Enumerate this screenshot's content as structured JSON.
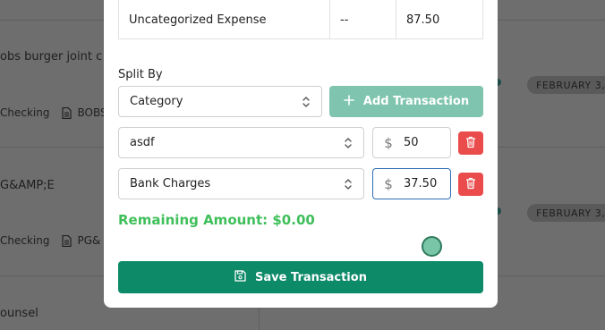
{
  "background": {
    "rows": [
      {
        "merchant": "obs burger joint c",
        "account": "Checking",
        "memo": "BOBS",
        "date": "FEBRUARY 3,"
      },
      {
        "merchant": "G&AMP;E",
        "account": "Checking",
        "memo": "PG&",
        "date": "FEBRUARY 3,"
      },
      {
        "merchant": "ounsel"
      }
    ]
  },
  "modal": {
    "table_row": {
      "category": "Uncategorized Expense",
      "col2": "--",
      "amount": "87.50"
    },
    "split_by_label": "Split By",
    "split_by_value": "Category",
    "add_transaction_label": "Add Transaction",
    "splits": [
      {
        "category": "asdf",
        "amount": "50"
      },
      {
        "category": "Bank Charges",
        "amount": "37.50"
      }
    ],
    "currency_symbol": "$",
    "remaining_text": "Remaining Amount: $0.00",
    "save_label": "Save Transaction"
  },
  "colors": {
    "save_button": "#0d8a68",
    "add_button_disabled": "#7fc4ae",
    "delete_button": "#ea4c4c",
    "remaining_text": "#3fbf5a",
    "focus_border": "#2f6db5"
  },
  "icons": {
    "add": "plus-icon",
    "delete": "trash-icon",
    "save": "floppy-disk-icon",
    "select": "chevron-up-down-icon",
    "memo": "document-icon"
  }
}
